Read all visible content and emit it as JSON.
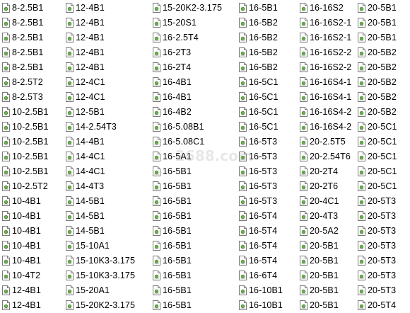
{
  "icon": "document-file-icon",
  "watermark": "2688.com",
  "columns": [
    [
      "8-2.5B1",
      "8-2.5B1",
      "8-2.5B1",
      "8-2.5B1",
      "8-2.5B1",
      "8-2.5T2",
      "8-2.5T3",
      "10-2.5B1",
      "10-2.5B1",
      "10-2.5B1",
      "10-2.5B1",
      "10-2.5B1",
      "10-2.5T2",
      "10-4B1",
      "10-4B1",
      "10-4B1",
      "10-4B1",
      "10-4B1",
      "10-4T2",
      "12-4B1",
      "12-4B1"
    ],
    [
      "12-4B1",
      "12-4B1",
      "12-4B1",
      "12-4B1",
      "12-4B1",
      "12-4C1",
      "12-4C1",
      "12-5B1",
      "14-2.54T3",
      "14-4B1",
      "14-4C1",
      "14-4C1",
      "14-4T3",
      "14-5B1",
      "14-5B1",
      "14-5B1",
      "15-10A1",
      "15-10K3-3.175",
      "15-10K3-3.175",
      "15-20A1",
      "15-20K2-3.175"
    ],
    [
      "15-20K2-3.175",
      "15-20S1",
      "16-2.5T4",
      "16-2T3",
      "16-2T4",
      "16-4B1",
      "16-4B1",
      "16-4B2",
      "16-5.08B1",
      "16-5.08C1",
      "16-5A1",
      "16-5B1",
      "16-5B1",
      "16-5B1",
      "16-5B1",
      "16-5B1",
      "16-5B1",
      "16-5B1",
      "16-5B1",
      "16-5B1",
      "16-5B1"
    ],
    [
      "16-5B1",
      "16-5B2",
      "16-5B2",
      "16-5B2",
      "16-5B2",
      "16-5C1",
      "16-5C1",
      "16-5C1",
      "16-5C1",
      "16-5T3",
      "16-5T3",
      "16-5T3",
      "16-5T3",
      "16-5T3",
      "16-5T4",
      "16-5T4",
      "16-5T4",
      "16-5T4",
      "16-6T4",
      "16-10B1",
      "16-10B1"
    ],
    [
      "16-16S2",
      "16-16S2-1",
      "16-16S2-1",
      "16-16S2-2",
      "16-16S2-2",
      "16-16S4-1",
      "16-16S4-1",
      "16-16S4-2",
      "16-16S4-2",
      "20-2.5T5",
      "20-2.54T6",
      "20-2T4",
      "20-2T6",
      "20-4C1",
      "20-4T3",
      "20-5A2",
      "20-5B1",
      "20-5B1",
      "20-5B1",
      "20-5B1",
      "20-5B1"
    ],
    [
      "20-5B1",
      "20-5B1",
      "20-5B1",
      "20-5B2",
      "20-5B2",
      "20-5B2",
      "20-5B2",
      "20-5B2",
      "20-5C1",
      "20-5C1",
      "20-5C1",
      "20-5C1",
      "20-5C1",
      "20-5T3",
      "20-5T3",
      "20-5T3",
      "20-5T3",
      "20-5T3",
      "20-5T3",
      "20-5T3",
      "20-5T4"
    ]
  ]
}
